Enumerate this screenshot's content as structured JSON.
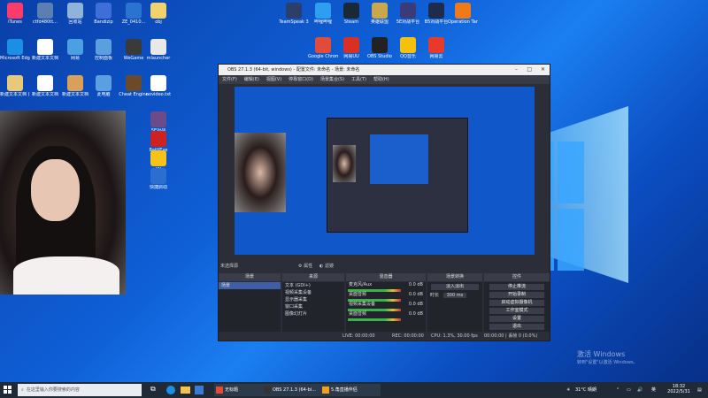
{
  "desktop": {
    "icons_row1": [
      {
        "label": "iTunes",
        "color": "#ff3b6b"
      },
      {
        "label": "ctfd480tt...",
        "color": "#5a7fb0"
      },
      {
        "label": "回收站",
        "color": "#8fb3d9"
      },
      {
        "label": "Bandizip",
        "color": "#3e6fd8"
      },
      {
        "label": "ZE_0410...",
        "color": "#2a74d0"
      },
      {
        "label": "obj",
        "color": "#f2d36b"
      }
    ],
    "icons_top_apps": [
      {
        "label": "TeamSpeak 3",
        "color": "#2c3f6b"
      },
      {
        "label": "哔哩哔哩",
        "color": "#2e9ff0"
      },
      {
        "label": "Steam",
        "color": "#1b2838"
      },
      {
        "label": "英雄联盟",
        "color": "#c8a84b"
      },
      {
        "label": "5E对战平台",
        "color": "#3b3b7a"
      },
      {
        "label": "B5对战平台",
        "color": "#1e2b4a"
      },
      {
        "label": "Operation Tango",
        "color": "#f07a1a"
      }
    ],
    "icons_row_apps2": [
      {
        "label": "Google Chrome",
        "color": "#e24a3b"
      },
      {
        "label": "网易UU",
        "color": "#d93025"
      },
      {
        "label": "OBS Studio",
        "color": "#222"
      },
      {
        "label": "QQ音乐",
        "color": "#f4c20d"
      },
      {
        "label": "网易云",
        "color": "#e83a2a"
      }
    ],
    "icons_left": [
      {
        "label": "Microsoft Edge",
        "color": "#1a8fe3"
      },
      {
        "label": "新建文本文档",
        "color": "#ffffff"
      },
      {
        "label": "网易",
        "color": "#4aa0e0"
      },
      {
        "label": "控制面板",
        "color": "#5aa0e0"
      },
      {
        "label": "WeGame",
        "color": "#3a3a3a"
      },
      {
        "label": "mlauncher",
        "color": "#e8e8e8"
      },
      {
        "label": "新建文本文档 (2)",
        "color": "#e8c97a"
      },
      {
        "label": "新建文本文档",
        "color": "#ffffff"
      },
      {
        "label": "新建文本文档",
        "color": "#d9a05a"
      },
      {
        "label": "此电脑",
        "color": "#5aa0e0"
      },
      {
        "label": "Cheat Engine",
        "color": "#6a4a2a"
      },
      {
        "label": "novideo.txt",
        "color": "#ffffff"
      }
    ],
    "icons_near_cam": [
      {
        "label": "5E对战",
        "color": "#6b4b8a"
      },
      {
        "label": "BattlEye",
        "color": "#c22"
      },
      {
        "label": "YY",
        "color": "#f7c21a"
      },
      {
        "label": "快捷启动",
        "color": "#2a6fd0"
      }
    ],
    "activation_title": "激活 Windows",
    "activation_sub": "转到\"设置\"以激活 Windows。"
  },
  "obs": {
    "title": "OBS 27.1.3 (64-bit, windows) - 配置文件: 未命名 - 场景: 未命名",
    "menu": [
      "文件(F)",
      "编辑(E)",
      "视图(V)",
      "停靠窗口(D)",
      "场景集合(S)",
      "工具(T)",
      "帮助(H)"
    ],
    "no_source": "未选择源",
    "props_btn": "属性",
    "filters_btn": "滤镜",
    "docks": {
      "scenes": "场景",
      "sources": "来源",
      "mixer": "混音器",
      "transitions": "场景转换",
      "controls": "控件"
    },
    "scenes_list": [
      "场景"
    ],
    "sources_list": [
      "文本 (GDI+)",
      "视频采集设备",
      "显示器采集",
      "窗口采集",
      "图像幻灯片"
    ],
    "mixer_tracks": [
      {
        "name": "麦克风/Aux",
        "db": "0.0 dB"
      },
      {
        "name": "桌面音频",
        "db": "0.0 dB"
      },
      {
        "name": "视频采集设备",
        "db": "0.0 dB"
      },
      {
        "name": "桌面音频",
        "db": "0.0 dB"
      }
    ],
    "transition": {
      "type": "淡入淡出",
      "duration_label": "时长",
      "duration": "300 ms"
    },
    "controls": [
      "停止推流",
      "开始录制",
      "启动虚拟摄像机",
      "工作室模式",
      "设置",
      "退出"
    ],
    "status": {
      "live": "LIVE: 00:00:00",
      "rec": "REC: 00:00:00",
      "cpu": "CPU: 1.3%, 30.00 fps",
      "extra": "00:00:00 | 丢帧 0 (0.0%)"
    }
  },
  "taskbar": {
    "search_placeholder": "在这里输入你要搜索的内容",
    "tasks": [
      {
        "label": "无标题",
        "color": "#e24a3b"
      },
      {
        "label": "OBS 27.1.3 (64-bi...",
        "color": "#333"
      },
      {
        "label": "5.角直播伴侣",
        "color": "#f0a020"
      }
    ],
    "weather": "31°C 晴朗",
    "time": "18:32",
    "date": "2022/5/31"
  }
}
